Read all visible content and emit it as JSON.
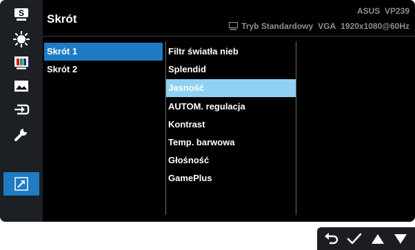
{
  "sidebar": {
    "items": [
      {
        "name": "splendid-s-icon",
        "active": false,
        "glyph": "S"
      },
      {
        "name": "blue-light-icon",
        "active": false
      },
      {
        "name": "color-icon",
        "active": false
      },
      {
        "name": "image-icon",
        "active": false
      },
      {
        "name": "input-select-icon",
        "active": false
      },
      {
        "name": "system-setup-icon",
        "active": false
      },
      {
        "name": "shortcut-icon",
        "active": true
      }
    ]
  },
  "header": {
    "title": "Skrót",
    "brand": "ASUS",
    "model": "VP239",
    "mode": "Tryb Standardowy",
    "input": "VGA",
    "resolution": "1920x1080@60Hz"
  },
  "menu": {
    "level1": [
      "Skrót 1",
      "Skrót 2"
    ],
    "level1_selected": 0,
    "level2": [
      "Filtr światła nieb",
      "Splendid",
      "Jasność",
      "AUTOM. regulacja",
      "Kontrast",
      "Temp. barwowa",
      "Głośność",
      "GamePlus"
    ],
    "level2_selected": 2
  },
  "nav_buttons": [
    "back-icon",
    "confirm-check-icon",
    "up-arrow-icon",
    "down-arrow-icon"
  ],
  "colors": {
    "accent": "#1f7bc4",
    "highlight": "#8fd1f3",
    "header_text": "#8d8f93"
  }
}
